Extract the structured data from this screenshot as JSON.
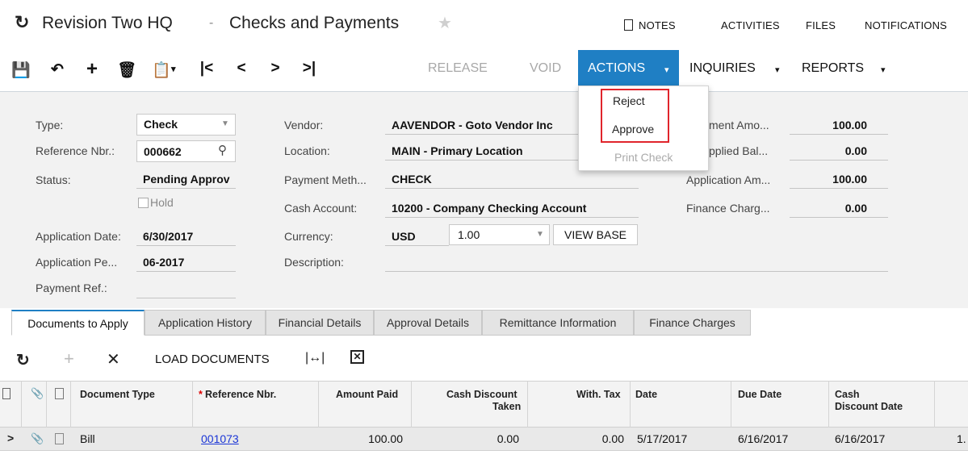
{
  "window": {
    "company": "Revision Two HQ",
    "separator": "-",
    "screen_title": "Checks and Payments",
    "top_links": [
      "NOTES",
      "ACTIVITIES",
      "FILES",
      "NOTIFICATIONS"
    ]
  },
  "toolbar": {
    "release_label": "RELEASE",
    "void_label": "VOID",
    "actions_label": "ACTIONS",
    "inquiries_label": "INQUIRIES",
    "reports_label": "REPORTS",
    "accent_color": "#1f7fc4"
  },
  "actions_menu": {
    "items": [
      "Reject",
      "Approve",
      "Print Check"
    ],
    "highlight_color": "#e0252c"
  },
  "form": {
    "type_label": "Type:",
    "type_value": "Check",
    "ref_label": "Reference Nbr.:",
    "ref_value": "000662",
    "status_label": "Status:",
    "status_value": "Pending Approv",
    "hold_label": "Hold",
    "app_date_label": "Application Date:",
    "app_date_value": "6/30/2017",
    "app_period_label": "Application Pe...",
    "app_period_value": "06-2017",
    "payment_ref_label": "Payment Ref.:",
    "vendor_label": "Vendor:",
    "vendor_value": "AAVENDOR - Goto Vendor Inc",
    "location_label": "Location:",
    "location_value": "MAIN - Primary Location",
    "payment_method_label": "Payment Meth...",
    "payment_method_value": "CHECK",
    "cash_account_label": "Cash Account:",
    "cash_account_value": "10200 - Company Checking Account",
    "currency_label": "Currency:",
    "currency_value": "USD",
    "rate_value": "1.00",
    "view_base_label": "VIEW BASE",
    "description_label": "Description:",
    "payment_amount_label": "ment Amo...",
    "payment_amount_value": "100.00",
    "unapplied_label": "pplied Bal...",
    "unapplied_value": "0.00",
    "application_amount_label": "Application Am...",
    "application_amount_value": "100.00",
    "finance_charge_label": "Finance Charg...",
    "finance_charge_value": "0.00"
  },
  "tabs": [
    "Documents to Apply",
    "Application History",
    "Financial Details",
    "Approval Details",
    "Remittance Information",
    "Finance Charges"
  ],
  "grid": {
    "load_documents_label": "LOAD DOCUMENTS",
    "headers": {
      "document_type": "Document Type",
      "reference_nbr": "Reference Nbr.",
      "required_mark": "*",
      "amount_paid": "Amount Paid",
      "cash_discount_taken_1": "Cash Discount",
      "cash_discount_taken_2": "Taken",
      "with_tax": "With. Tax",
      "date": "Date",
      "due_date": "Due Date",
      "cash_discount_date_1": "Cash",
      "cash_discount_date_2": "Discount Date"
    },
    "rows": [
      {
        "document_type": "Bill",
        "reference_nbr": "001073",
        "amount_paid": "100.00",
        "cash_discount_taken": "0.00",
        "with_tax": "0.00",
        "date": "5/17/2017",
        "due_date": "6/16/2017",
        "cash_discount_date": "6/16/2017",
        "overflow": "1."
      }
    ]
  }
}
